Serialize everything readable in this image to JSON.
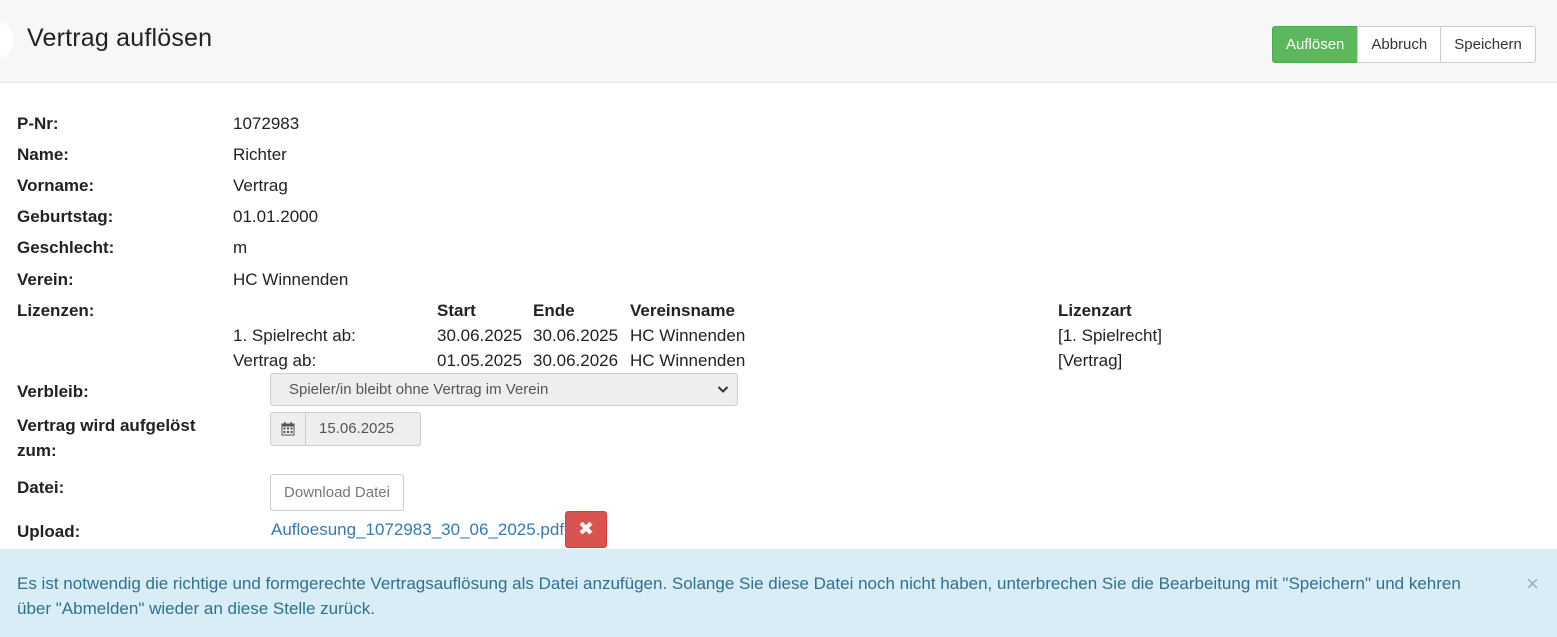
{
  "header": {
    "title": "Vertrag auflösen",
    "buttons": {
      "resolve": "Auflösen",
      "cancel": "Abbruch",
      "save": "Speichern"
    }
  },
  "fields": {
    "pnr": {
      "label": "P-Nr:",
      "value": "1072983"
    },
    "name": {
      "label": "Name:",
      "value": "Richter"
    },
    "vorname": {
      "label": "Vorname:",
      "value": "Vertrag"
    },
    "geburtstag": {
      "label": "Geburtstag:",
      "value": "01.01.2000"
    },
    "geschlecht": {
      "label": "Geschlecht:",
      "value": "m"
    },
    "verein": {
      "label": "Verein:",
      "value": "HC Winnenden"
    }
  },
  "lizenzen": {
    "label": "Lizenzen:",
    "headers": {
      "start": "Start",
      "ende": "Ende",
      "vereinsname": "Vereinsname",
      "lizenzart": "Lizenzart"
    },
    "rows": [
      {
        "type": "1. Spielrecht ab:",
        "start": "30.06.2025",
        "ende": "30.06.2025",
        "verein": "HC Winnenden",
        "art": "[1. Spielrecht]"
      },
      {
        "type": "Vertrag ab:",
        "start": "01.05.2025",
        "ende": "30.06.2026",
        "verein": "HC Winnenden",
        "art": "[Vertrag]"
      }
    ]
  },
  "verbleib": {
    "label": "Verbleib:",
    "selected": "Spieler/in bleibt ohne Vertrag im Verein"
  },
  "aufgeloest": {
    "label_line1": "Vertrag wird aufgelöst",
    "label_line2": "zum:",
    "date": "15.06.2025"
  },
  "datei": {
    "label": "Datei:",
    "button": "Download Datei"
  },
  "upload": {
    "label": "Upload:",
    "filename": "Aufloesung_1072983_30_06_2025.pdf",
    "delete_glyph": "✖"
  },
  "alert": {
    "line1": "Es ist notwendig die richtige und formgerechte Vertragsauflösung als Datei anzufügen. Solange Sie diese Datei noch nicht haben, unterbrechen Sie die Bearbeitung mit \"Speichern\" und kehren",
    "line2": "über \"Abmelden\" wieder an diese Stelle zurück.",
    "close_glyph": "×"
  },
  "icons": {
    "calendar": "calendar-icon",
    "chevron": "chevron-down-icon",
    "delete": "delete-icon",
    "close": "close-icon"
  },
  "colors": {
    "success": "#5cb85c",
    "danger": "#d9534f",
    "link": "#337ab7",
    "info_bg": "#d9edf7",
    "info_text": "#31708f"
  }
}
